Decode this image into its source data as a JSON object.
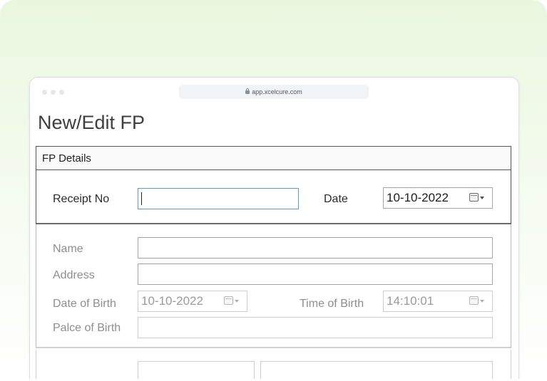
{
  "browser": {
    "url": "app.xcelcure.com"
  },
  "page": {
    "title": "New/Edit FP"
  },
  "section": {
    "header": "FP Details"
  },
  "receipt": {
    "receipt_label": "Receipt No",
    "receipt_value": "",
    "date_label": "Date",
    "date_value": "10-10-2022"
  },
  "personal": {
    "name_label": "Name",
    "name_value": "",
    "address_label": "Address",
    "address_value": "",
    "dob_label": "Date of Birth",
    "dob_value": "10-10-2022",
    "tob_label": "Time of Birth",
    "tob_value": "14:10:01",
    "pob_label": "Palce of Birth",
    "pob_value": ""
  },
  "icons": {
    "lock": "lock-icon",
    "calendar": "calendar-icon",
    "dropdown": "chevron-down-icon"
  },
  "colors": {
    "focus_border": "#5b9bd5",
    "background_tint": "#eaf7df"
  }
}
